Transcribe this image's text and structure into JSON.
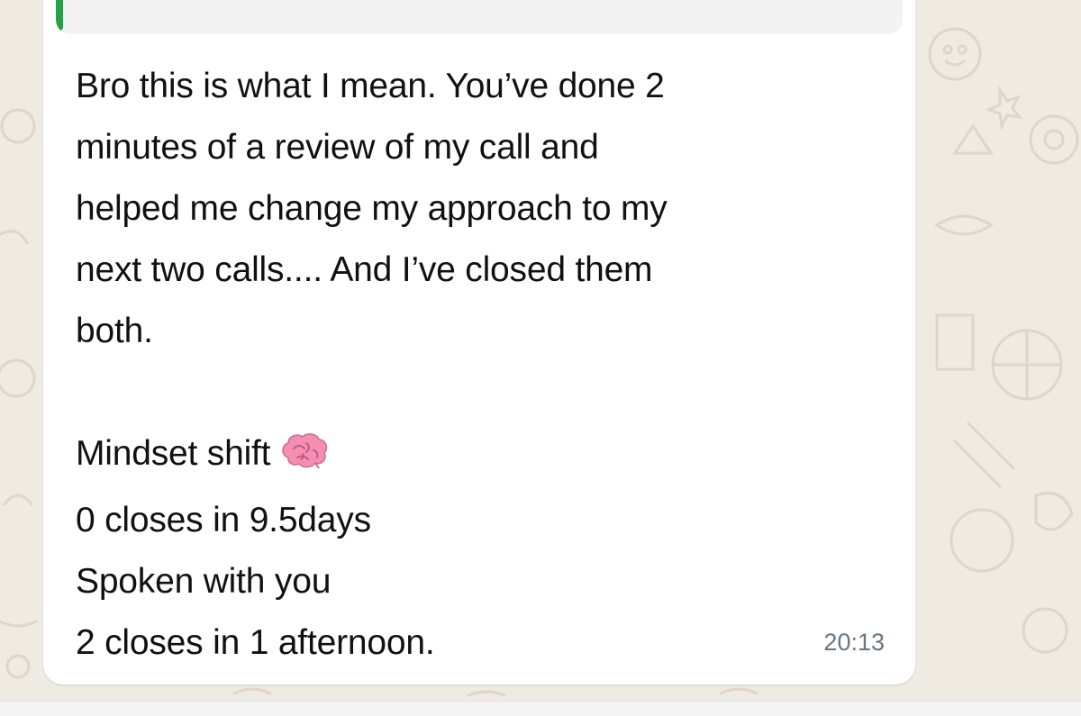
{
  "chat": {
    "message": {
      "paragraph1": "Bro this is what I mean. You’ve done 2\nminutes of a review of my call and\nhelped me change my approach to my\nnext two calls.... And I’ve closed them\nboth.",
      "line_mindset": "Mindset shift",
      "line_zero_closes": "0 closes in 9.5days",
      "line_spoken": "Spoken with you",
      "line_two_closes": "2 closes in 1 afternoon.",
      "emoji_icon": "brain-emoji-icon",
      "timestamp": "20:13"
    },
    "quoted_reply": {
      "accent_color": "#25a244"
    }
  },
  "colors": {
    "wallpaper": "#efeae2",
    "bubble": "#ffffff",
    "text": "#111111",
    "timestamp": "#667781"
  }
}
